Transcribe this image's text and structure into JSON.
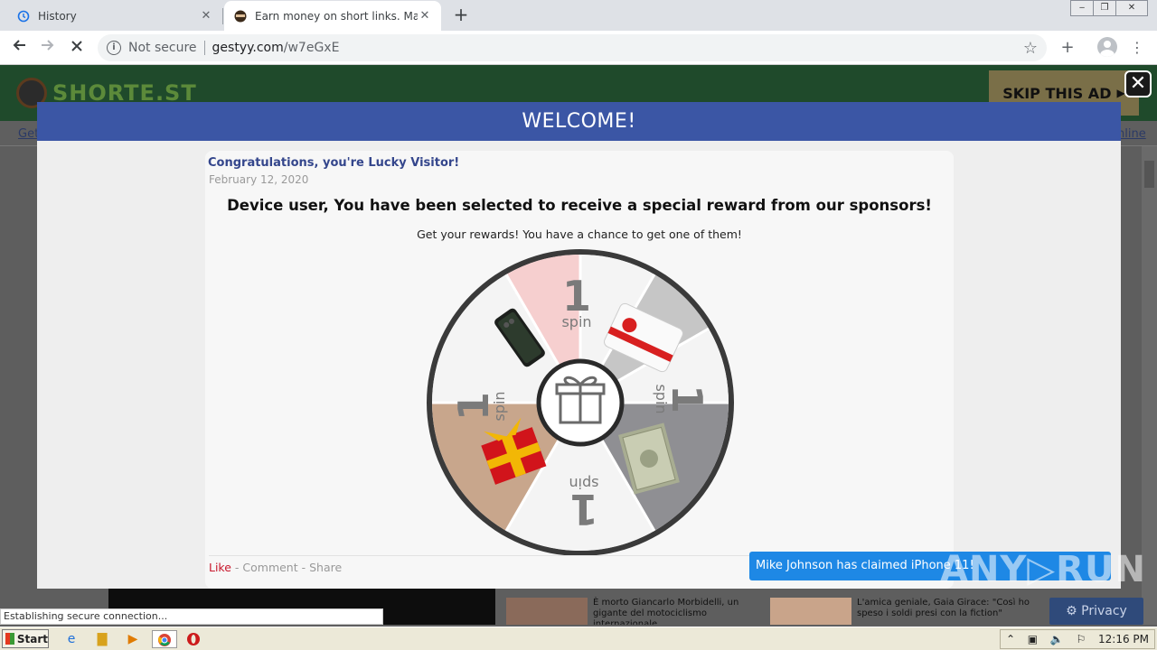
{
  "browser": {
    "tabs": [
      {
        "title": "History",
        "active": false
      },
      {
        "title": "Earn money on short links. Make sho",
        "active": true
      }
    ],
    "new_tab_symbol": "+",
    "tab_close_symbol": "✕",
    "address": {
      "security": "Not secure",
      "host": "gestyy.com",
      "path": "/w7eGxE"
    },
    "window_controls": [
      "‒",
      "❐",
      "✕"
    ]
  },
  "page": {
    "logo_text": "SHORTE.ST",
    "skip_ad": "SKIP THIS AD",
    "nav_left": "Get",
    "nav_right": "nline",
    "news": [
      {
        "caption": "È morto Giancarlo Morbidelli, un gigante del motociclismo internazionale"
      },
      {
        "caption": "L'amica geniale, Gaia Girace: \"Così ho speso i soldi presi con la fiction\""
      }
    ]
  },
  "modal": {
    "header": "WELCOME!",
    "post_title": "Congratulations, you're Lucky Visitor!",
    "post_date": "February 12, 2020",
    "headline": "Device user, You have been selected to receive a special reward from our sponsors!",
    "subline": "Get your rewards! You have a chance to get one of them!",
    "wheel": {
      "segment_number": "1",
      "segment_label": "spin"
    },
    "social": {
      "like": "Like",
      "comment": "Comment",
      "share": "Share",
      "separator": " - "
    }
  },
  "toast": "Mike Johnson has claimed iPhone 11!",
  "watermark": "ANY▷RUN",
  "privacy": "⚙ Privacy",
  "status_bar": "Establishing secure connection...",
  "taskbar": {
    "start": "Start",
    "clock": "12:16 PM"
  },
  "colors": {
    "modal_header": "#3b56a5",
    "toast": "#1e88e5",
    "like": "#c8182d"
  }
}
